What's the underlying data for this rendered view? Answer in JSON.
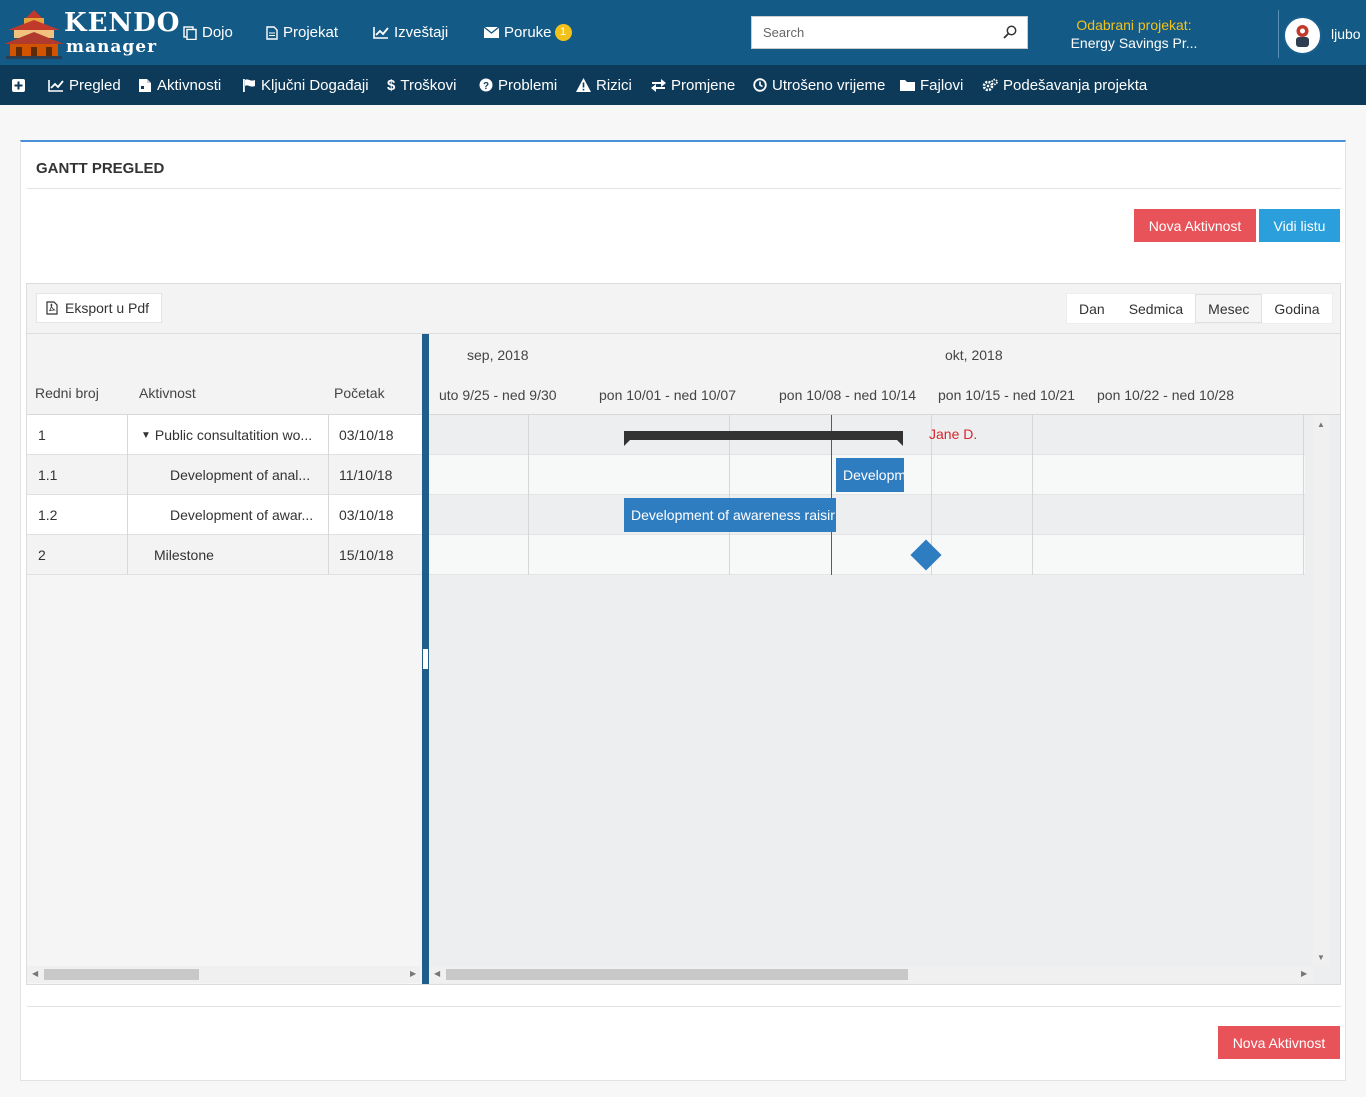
{
  "brand": {
    "line1": "KENDO",
    "line2": "manager"
  },
  "topnav": [
    {
      "label": "Dojo",
      "icon": "copy-icon"
    },
    {
      "label": "Projekat",
      "icon": "document-icon"
    },
    {
      "label": "Izveštaji",
      "icon": "chart-line-icon"
    },
    {
      "label": "Poruke",
      "icon": "envelope-icon",
      "badge": "1"
    }
  ],
  "search": {
    "placeholder": "Search"
  },
  "selected_project": {
    "label": "Odabrani projekat:",
    "name": "Energy Savings Pr..."
  },
  "user": {
    "name": "ljubo"
  },
  "subnav": [
    {
      "label": "",
      "icon": "plus-square-icon"
    },
    {
      "label": "Pregled",
      "icon": "chart-line-icon"
    },
    {
      "label": "Aktivnosti",
      "icon": "tasks-icon"
    },
    {
      "label": "Ključni Događaji",
      "icon": "flag-icon"
    },
    {
      "label": "Troškovi",
      "icon": "dollar-icon"
    },
    {
      "label": "Problemi",
      "icon": "question-circle-icon"
    },
    {
      "label": "Rizici",
      "icon": "warning-icon"
    },
    {
      "label": "Promjene",
      "icon": "exchange-icon"
    },
    {
      "label": "Utrošeno vrijeme",
      "icon": "clock-icon"
    },
    {
      "label": "Fajlovi",
      "icon": "folder-icon"
    },
    {
      "label": "Podešavanja projekta",
      "icon": "cogs-icon"
    }
  ],
  "panel": {
    "title": "GANTT PREGLED",
    "new_activity": "Nova Aktivnost",
    "view_list": "Vidi listu",
    "new_activity_bottom": "Nova Aktivnost"
  },
  "gantt": {
    "export_label": "Eksport u Pdf",
    "views": [
      "Dan",
      "Sedmica",
      "Mesec",
      "Godina"
    ],
    "active_view": "Mesec",
    "columns": {
      "number": "Redni broj",
      "activity": "Aktivnost",
      "start": "Početak"
    },
    "rows": [
      {
        "number": "1",
        "activity": "Public consultatition wo...",
        "start": "03/10/18",
        "expanded": true
      },
      {
        "number": "1.1",
        "activity": "Development of anal...",
        "start": "11/10/18"
      },
      {
        "number": "1.2",
        "activity": "Development of awar...",
        "start": "03/10/18"
      },
      {
        "number": "2",
        "activity": "Milestone",
        "start": "15/10/18"
      }
    ],
    "months": [
      "sep, 2018",
      "okt, 2018"
    ],
    "weeks": [
      "uto 9/25 - ned 9/30",
      "pon 10/01 - ned 10/07",
      "pon 10/08 - ned 10/14",
      "pon 10/15 - ned 10/21",
      "pon 10/22 - ned 10/28"
    ],
    "bars": {
      "summary_resource": "Jane D.",
      "task_1_1": "Developm",
      "task_1_2": "Development of awareness raisir"
    }
  }
}
